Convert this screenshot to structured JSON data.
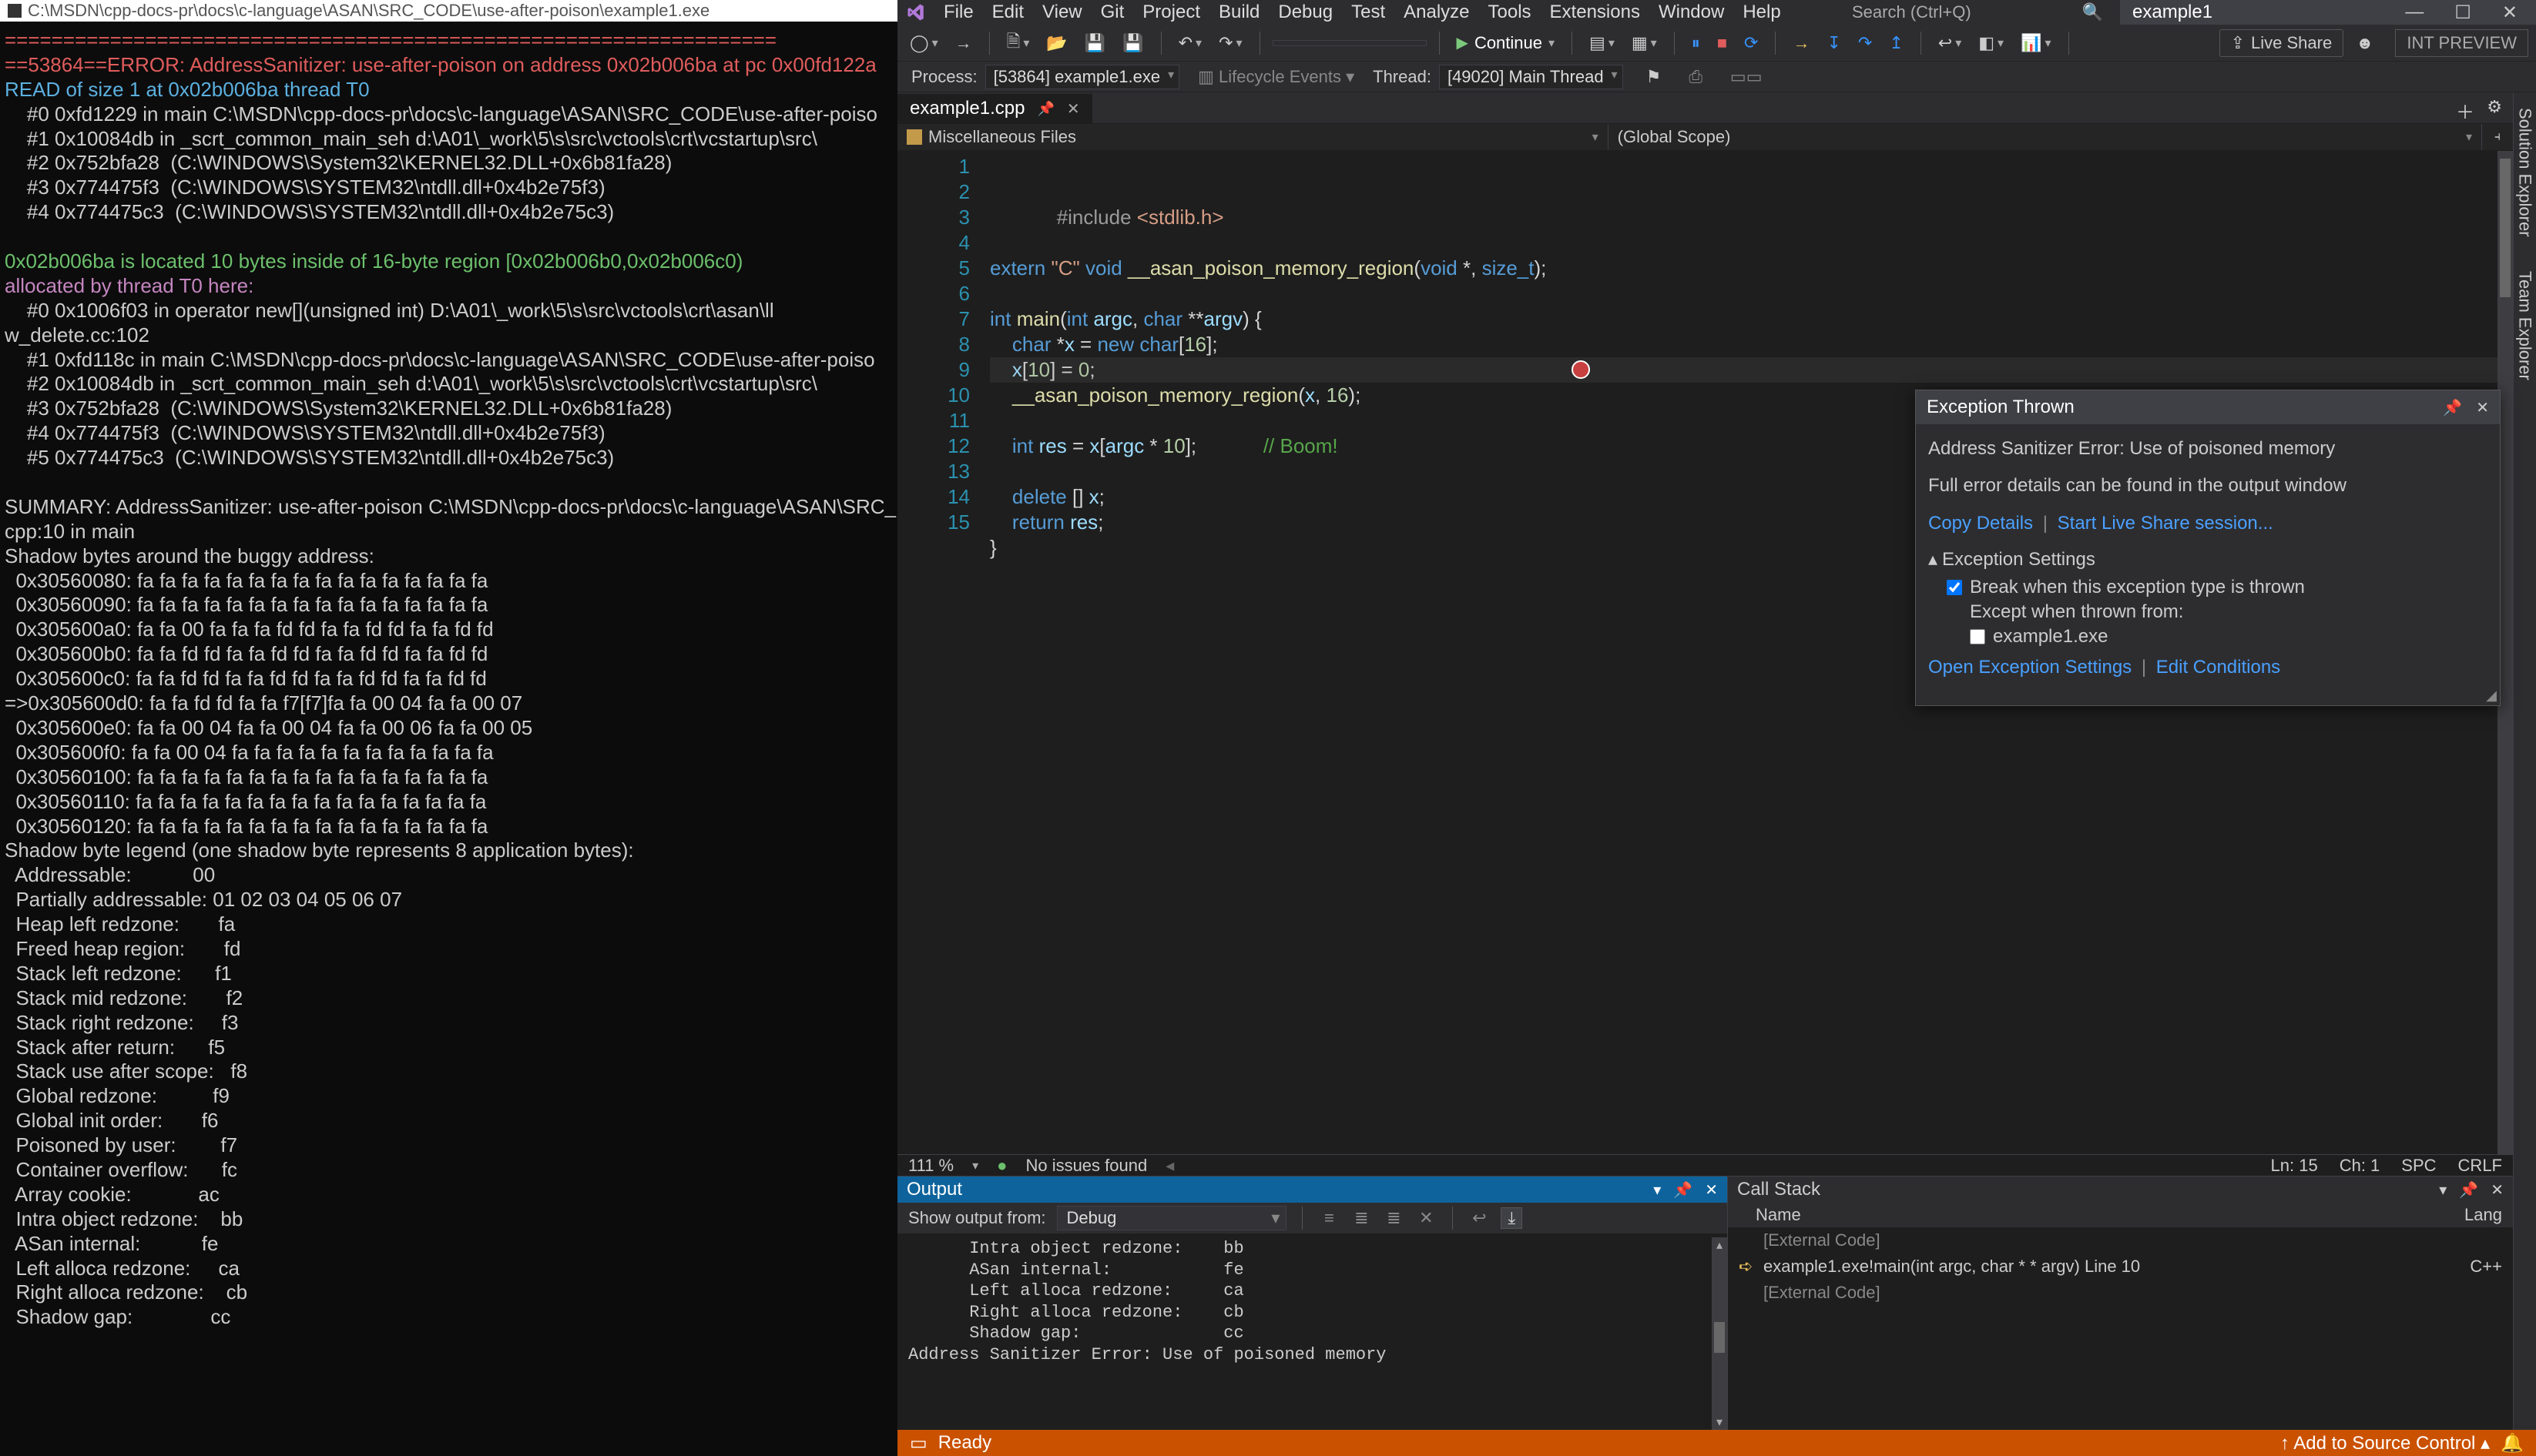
{
  "console": {
    "title": "C:\\MSDN\\cpp-docs-pr\\docs\\c-language\\ASAN\\SRC_CODE\\use-after-poison\\example1.exe",
    "lines": [
      {
        "c": "err",
        "t": "=================================================================="
      },
      {
        "c": "err",
        "t": "==53864==ERROR: AddressSanitizer: use-after-poison on address 0x02b006ba at pc 0x00fd122a"
      },
      {
        "c": "blue",
        "t": "READ of size 1 at 0x02b006ba thread T0"
      },
      {
        "c": "",
        "t": "    #0 0xfd1229 in main C:\\MSDN\\cpp-docs-pr\\docs\\c-language\\ASAN\\SRC_CODE\\use-after-poiso"
      },
      {
        "c": "",
        "t": "    #1 0x10084db in _scrt_common_main_seh d:\\A01\\_work\\5\\s\\src\\vctools\\crt\\vcstartup\\src\\"
      },
      {
        "c": "",
        "t": "    #2 0x752bfa28  (C:\\WINDOWS\\System32\\KERNEL32.DLL+0x6b81fa28)"
      },
      {
        "c": "",
        "t": "    #3 0x774475f3  (C:\\WINDOWS\\SYSTEM32\\ntdll.dll+0x4b2e75f3)"
      },
      {
        "c": "",
        "t": "    #4 0x774475c3  (C:\\WINDOWS\\SYSTEM32\\ntdll.dll+0x4b2e75c3)"
      },
      {
        "c": "",
        "t": ""
      },
      {
        "c": "green",
        "t": "0x02b006ba is located 10 bytes inside of 16-byte region [0x02b006b0,0x02b006c0)"
      },
      {
        "c": "purple",
        "t": "allocated by thread T0 here:"
      },
      {
        "c": "",
        "t": "    #0 0x1006f03 in operator new[](unsigned int) D:\\A01\\_work\\5\\s\\src\\vctools\\crt\\asan\\ll"
      },
      {
        "c": "",
        "t": "w_delete.cc:102"
      },
      {
        "c": "",
        "t": "    #1 0xfd118c in main C:\\MSDN\\cpp-docs-pr\\docs\\c-language\\ASAN\\SRC_CODE\\use-after-poiso"
      },
      {
        "c": "",
        "t": "    #2 0x10084db in _scrt_common_main_seh d:\\A01\\_work\\5\\s\\src\\vctools\\crt\\vcstartup\\src\\"
      },
      {
        "c": "",
        "t": "    #3 0x752bfa28  (C:\\WINDOWS\\System32\\KERNEL32.DLL+0x6b81fa28)"
      },
      {
        "c": "",
        "t": "    #4 0x774475f3  (C:\\WINDOWS\\SYSTEM32\\ntdll.dll+0x4b2e75f3)"
      },
      {
        "c": "",
        "t": "    #5 0x774475c3  (C:\\WINDOWS\\SYSTEM32\\ntdll.dll+0x4b2e75c3)"
      },
      {
        "c": "",
        "t": ""
      },
      {
        "c": "",
        "t": "SUMMARY: AddressSanitizer: use-after-poison C:\\MSDN\\cpp-docs-pr\\docs\\c-language\\ASAN\\SRC_"
      },
      {
        "c": "",
        "t": "cpp:10 in main"
      },
      {
        "c": "",
        "t": "Shadow bytes around the buggy address:"
      },
      {
        "c": "",
        "t": "  0x30560080: fa fa fa fa fa fa fa fa fa fa fa fa fa fa fa fa"
      },
      {
        "c": "",
        "t": "  0x30560090: fa fa fa fa fa fa fa fa fa fa fa fa fa fa fa fa"
      },
      {
        "c": "",
        "t": "  0x305600a0: fa fa 00 fa fa fa fd fd fa fa fd fd fa fa fd fd"
      },
      {
        "c": "",
        "t": "  0x305600b0: fa fa fd fd fa fa fd fd fa fa fd fd fa fa fd fd"
      },
      {
        "c": "",
        "t": "  0x305600c0: fa fa fd fd fa fa fd fd fa fa fd fd fa fa fd fd"
      },
      {
        "c": "",
        "t": "=>0x305600d0: fa fa fd fd fa fa f7[f7]fa fa 00 04 fa fa 00 07"
      },
      {
        "c": "",
        "t": "  0x305600e0: fa fa 00 04 fa fa 00 04 fa fa 00 06 fa fa 00 05"
      },
      {
        "c": "",
        "t": "  0x305600f0: fa fa 00 04 fa fa fa fa fa fa fa fa fa fa fa fa"
      },
      {
        "c": "",
        "t": "  0x30560100: fa fa fa fa fa fa fa fa fa fa fa fa fa fa fa fa"
      },
      {
        "c": "",
        "t": "  0x30560110: fa fa fa fa fa fa fa fa fa fa fa fa fa fa fa fa"
      },
      {
        "c": "",
        "t": "  0x30560120: fa fa fa fa fa fa fa fa fa fa fa fa fa fa fa fa"
      },
      {
        "c": "",
        "t": "Shadow byte legend (one shadow byte represents 8 application bytes):"
      },
      {
        "c": "",
        "t": "  Addressable:           00"
      },
      {
        "c": "",
        "t": "  Partially addressable: 01 02 03 04 05 06 07"
      },
      {
        "c": "",
        "t": "  Heap left redzone:       fa"
      },
      {
        "c": "",
        "t": "  Freed heap region:       fd"
      },
      {
        "c": "",
        "t": "  Stack left redzone:      f1"
      },
      {
        "c": "",
        "t": "  Stack mid redzone:       f2"
      },
      {
        "c": "",
        "t": "  Stack right redzone:     f3"
      },
      {
        "c": "",
        "t": "  Stack after return:      f5"
      },
      {
        "c": "",
        "t": "  Stack use after scope:   f8"
      },
      {
        "c": "",
        "t": "  Global redzone:          f9"
      },
      {
        "c": "",
        "t": "  Global init order:       f6"
      },
      {
        "c": "",
        "t": "  Poisoned by user:        f7"
      },
      {
        "c": "",
        "t": "  Container overflow:      fc"
      },
      {
        "c": "",
        "t": "  Array cookie:            ac"
      },
      {
        "c": "",
        "t": "  Intra object redzone:    bb"
      },
      {
        "c": "",
        "t": "  ASan internal:           fe"
      },
      {
        "c": "",
        "t": "  Left alloca redzone:     ca"
      },
      {
        "c": "",
        "t": "  Right alloca redzone:    cb"
      },
      {
        "c": "",
        "t": "  Shadow gap:              cc"
      }
    ]
  },
  "vs": {
    "solutionTab": "example1",
    "menu": [
      "File",
      "Edit",
      "View",
      "Git",
      "Project",
      "Build",
      "Debug",
      "Test",
      "Analyze",
      "Tools",
      "Extensions",
      "Window",
      "Help"
    ],
    "searchPlaceholder": "Search (Ctrl+Q)",
    "toolbar": {
      "continue": "Continue",
      "liveShare": "Live Share",
      "intPreview": "INT PREVIEW"
    },
    "process": {
      "label": "Process:",
      "value": "[53864] example1.exe",
      "life": "Lifecycle Events",
      "threadLabel": "Thread:",
      "threadValue": "[49020] Main Thread"
    },
    "docTab": "example1.cpp",
    "scope1": "Miscellaneous Files",
    "scope2": "(Global Scope)",
    "code": {
      "numbers": "1\n2\n3\n4\n5\n6\n7\n8\n9\n10\n11\n12\n13\n14\n15"
    },
    "exception": {
      "title": "Exception Thrown",
      "msg": "Address Sanitizer Error: Use of poisoned memory",
      "detail": "Full error details can be found in the output window",
      "copy": "Copy Details",
      "startLS": "Start Live Share session...",
      "settingsHdr": "Exception Settings",
      "break": "Break when this exception type is thrown",
      "except": "Except when thrown from:",
      "exe": "example1.exe",
      "open": "Open Exception Settings",
      "edit": "Edit Conditions"
    },
    "statusbar": {
      "zoom": "111 %",
      "issues": "No issues found",
      "ln": "Ln: 15",
      "ch": "Ch: 1",
      "spc": "SPC",
      "crlf": "CRLF"
    },
    "output": {
      "title": "Output",
      "showFrom": "Show output from:",
      "source": "Debug",
      "body": "      Intra object redzone:    bb\n      ASan internal:           fe\n      Left alloca redzone:     ca\n      Right alloca redzone:    cb\n      Shadow gap:              cc\nAddress Sanitizer Error: Use of poisoned memory\n"
    },
    "callstack": {
      "title": "Call Stack",
      "colName": "Name",
      "colLang": "Lang",
      "rows": [
        {
          "arrow": "",
          "text": "[External Code]",
          "lang": "",
          "dim": true
        },
        {
          "arrow": "➪",
          "text": "example1.exe!main(int argc, char * * argv) Line 10",
          "lang": "C++",
          "dim": false
        },
        {
          "arrow": "",
          "text": "[External Code]",
          "lang": "",
          "dim": true
        }
      ]
    },
    "sideTabs": [
      "Solution Explorer",
      "Team Explorer"
    ],
    "footer": {
      "ready": "Ready",
      "addSrc": "Add to Source Control"
    }
  }
}
